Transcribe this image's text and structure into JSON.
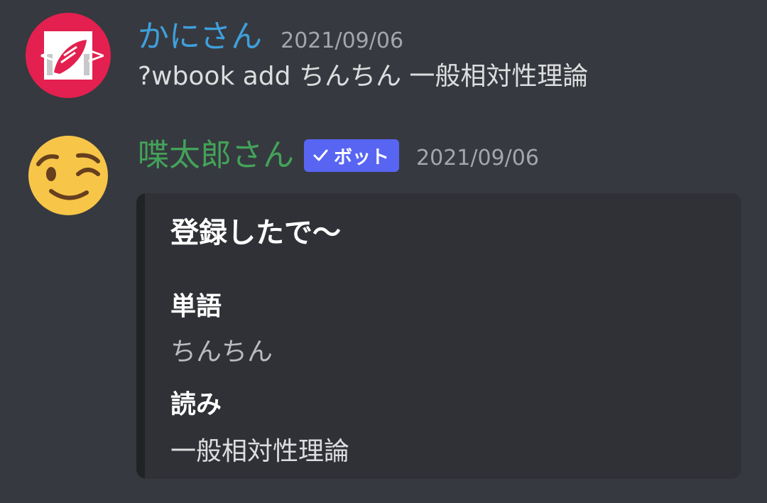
{
  "messages": [
    {
      "username": "かにさん",
      "username_color": "#3ea0dc",
      "timestamp": "2021/09/06",
      "content": "?wbook add ちんちん 一般相対性理論",
      "avatar_icon": "crab-logo-icon",
      "avatar_bg": "#e3204f"
    },
    {
      "username": "喋太郎さん",
      "username_color": "#43a25a",
      "timestamp": "2021/09/06",
      "bot_tag": "ボット",
      "avatar_icon": "winking-face-icon",
      "embed": {
        "title": "登録したで〜",
        "fields": [
          {
            "name": "単語",
            "value": "ちんちん"
          },
          {
            "name": "読み",
            "value": "一般相対性理論"
          }
        ]
      }
    }
  ],
  "colors": {
    "background": "#36393f",
    "embed_bg": "#2f3136",
    "bot_tag_bg": "#5865f2",
    "timestamp": "#a3a6aa"
  }
}
